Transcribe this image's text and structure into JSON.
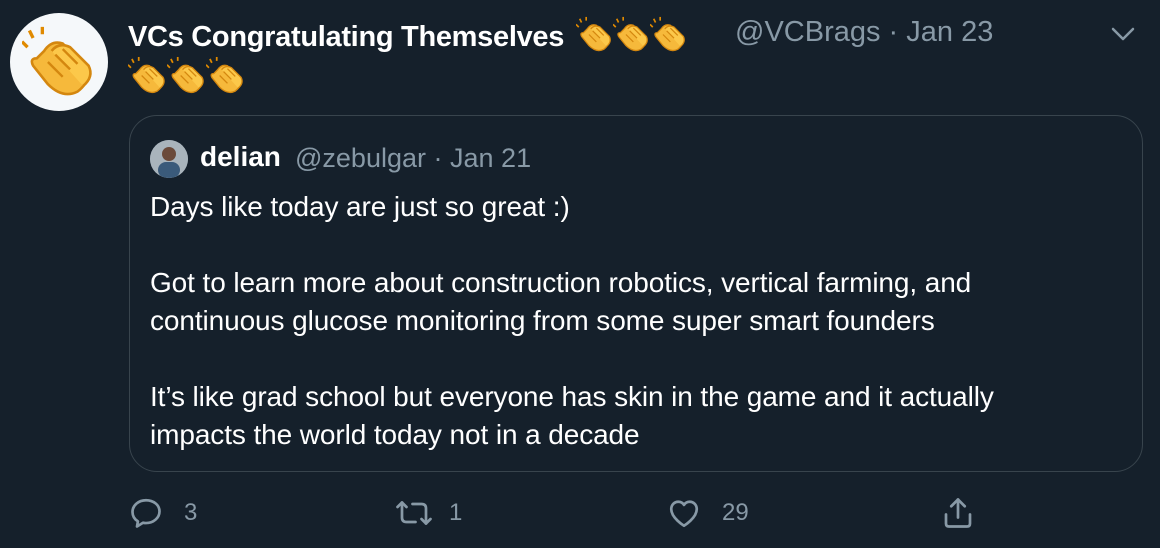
{
  "tweet": {
    "display_name": "VCs Congratulating Themselves",
    "name_emoji": "clapping-hands-emoji",
    "handle": "@VCBrags",
    "date": "Jan 23",
    "bio_emoji": "clapping-hands-emoji"
  },
  "quoted_tweet": {
    "display_name": "delian",
    "handle": "@zebulgar",
    "date": "Jan 21",
    "separator": "·",
    "text": "Days like today are just so great :)\n\nGot to learn more about construction robotics, vertical farming, and\ncontinuous glucose monitoring from some super smart founders\n\nIt’s like grad school but everyone has skin in the game and it actually\nimpacts the world today not in a decade"
  },
  "actions": {
    "reply_count": "3",
    "retweet_count": "1",
    "like_count": "29"
  },
  "colors": {
    "background": "#15202b",
    "secondary_text": "#8899a6",
    "border": "#38444d"
  },
  "icons": [
    "clapping-hands-icon",
    "chevron-down-icon",
    "reply-icon",
    "retweet-icon",
    "like-icon",
    "share-icon"
  ]
}
